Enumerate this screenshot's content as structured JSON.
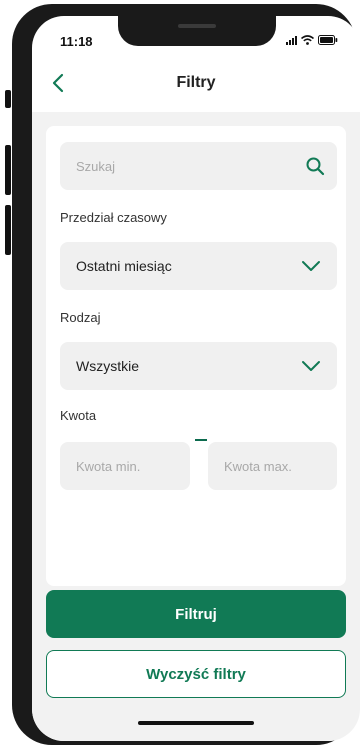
{
  "status": {
    "time": "11:18"
  },
  "header": {
    "title": "Filtry"
  },
  "search": {
    "placeholder": "Szukaj"
  },
  "period": {
    "label": "Przedział czasowy",
    "selected": "Ostatni miesiąc"
  },
  "type": {
    "label": "Rodzaj",
    "selected": "Wszystkie"
  },
  "amount": {
    "label": "Kwota",
    "min_placeholder": "Kwota min.",
    "max_placeholder": "Kwota max."
  },
  "actions": {
    "filter_label": "Filtruj",
    "clear_label": "Wyczyść filtry"
  },
  "colors": {
    "accent": "#117a55",
    "background": "#f2f2f2"
  },
  "icons": [
    "back-chevron",
    "search",
    "chevron-down"
  ]
}
